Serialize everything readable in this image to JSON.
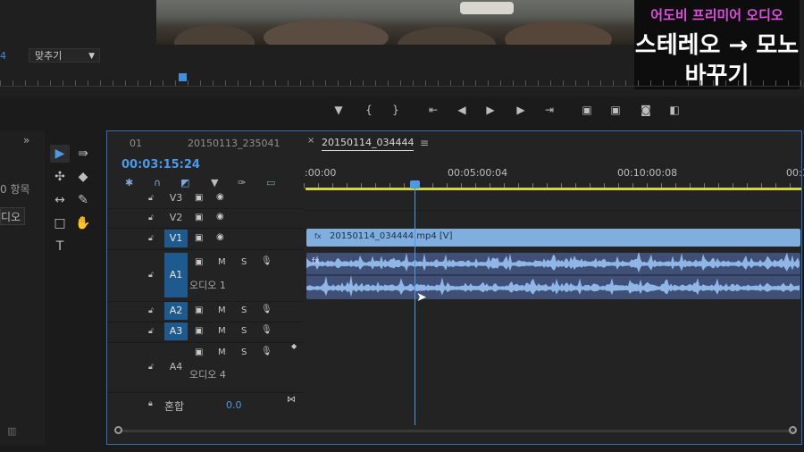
{
  "thumbnail": {
    "line1": "어도비 프리미어 오디오",
    "line2": "스테레오 → 모노",
    "line3": "바꾸기"
  },
  "monitor": {
    "fit_prefix": "4",
    "fit_label": "맞추기"
  },
  "left_panel": {
    "collapse_icon": "»",
    "items_label": "0 항목",
    "field_text": "디오"
  },
  "timeline": {
    "tabs": [
      "01",
      "20150113_235041",
      "20150114_034444"
    ],
    "tab_menu": "≡",
    "timecode": "00:03:15:24",
    "ruler_labels": [
      ":00:00",
      "00:05:00:04",
      "00:10:00:08",
      "00:1"
    ],
    "tracks": [
      {
        "name": "V3",
        "type": "video"
      },
      {
        "name": "V2",
        "type": "video"
      },
      {
        "name": "V1",
        "type": "video",
        "active": true
      },
      {
        "name": "A1",
        "type": "audio",
        "active": true,
        "label": "오디오 1"
      },
      {
        "name": "A2",
        "type": "audio",
        "active": true
      },
      {
        "name": "A3",
        "type": "audio",
        "active": true
      },
      {
        "name": "A4",
        "type": "audio",
        "label": "오디오 4"
      }
    ],
    "mix_label": "혼합",
    "mix_value": "0.0",
    "video_clip_name": "20150114_034444.mp4 [V]",
    "icons": {
      "M": "M",
      "S": "S"
    }
  },
  "colors": {
    "accent": "#4a9ae8",
    "track_active": "#1f5a8e",
    "video_clip": "#7faedf",
    "audio_clip": "#3f4f75"
  }
}
